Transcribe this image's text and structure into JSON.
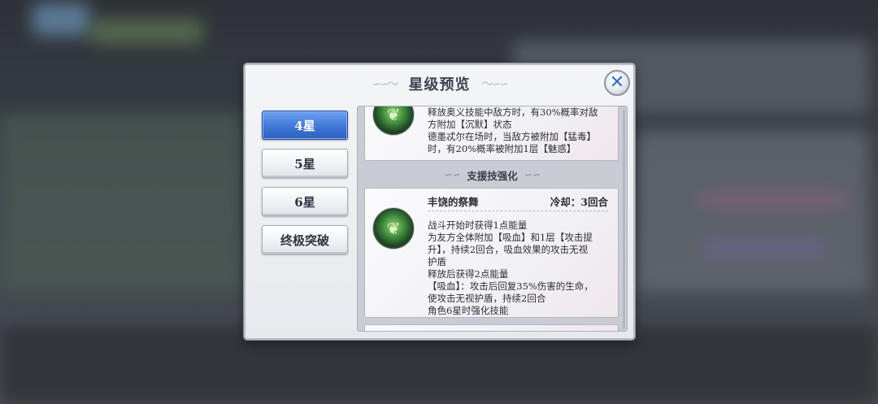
{
  "dialog": {
    "title": "星级预览",
    "close_icon": "close-icon"
  },
  "tabs": [
    {
      "label": "4星",
      "active": true
    },
    {
      "label": "5星",
      "active": false
    },
    {
      "label": "6星",
      "active": false
    },
    {
      "label": "终极突破",
      "active": false
    }
  ],
  "panel": {
    "card1": {
      "lines": [
        "释放奥义技能中敌方时，有30%概率对敌",
        "方附加【沉默】状态",
        "德墨忒尔在场时，当敌方被附加【猛毒】",
        "时，有20%概率被附加1层【魅惑】"
      ]
    },
    "section_label": "支援技强化",
    "card2": {
      "name": "丰饶的祭舞",
      "cooldown": "冷却：3回合",
      "lines": [
        "战斗开始时获得1点能量",
        "为友方全体附加【吸血】和1层【攻击提",
        "升】，持续2回合，吸血效果的攻击无视",
        "护盾",
        "释放后获得2点能量",
        "【吸血】：攻击后回复35%伤害的生命，",
        "使攻击无视护盾，持续2回合",
        "角色6星时强化技能"
      ]
    }
  }
}
